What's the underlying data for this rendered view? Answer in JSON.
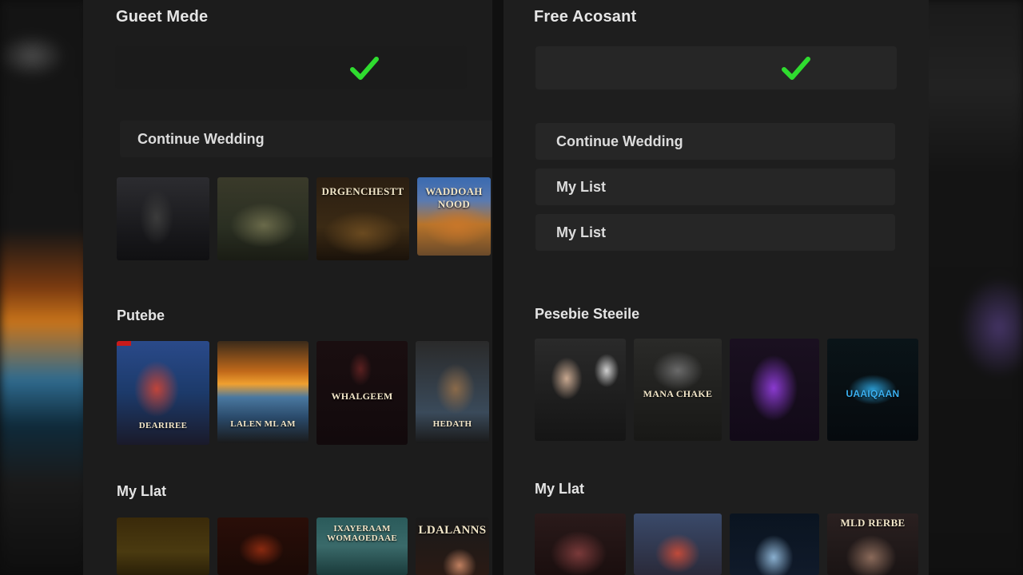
{
  "guest": {
    "title": "Gueet Mede",
    "continue_label": "Continue Wedding",
    "sections": {
      "continue_row": [
        {
          "name": "poster-dark-figures",
          "text": ""
        },
        {
          "name": "poster-table-group",
          "text": ""
        },
        {
          "name": "poster-grenches",
          "text": "DRGENCHESTT"
        },
        {
          "name": "poster-crowd",
          "text": "WADDOAH NOOD"
        }
      ],
      "popular_title": "Putebe",
      "popular_row": [
        {
          "name": "poster-dancers",
          "text": "DEARIREE"
        },
        {
          "name": "poster-sunset",
          "text": "LALEN ML AM"
        },
        {
          "name": "poster-shadow",
          "text": "WHALGEEM"
        },
        {
          "name": "poster-creature",
          "text": "HEDATH"
        }
      ],
      "mylist_title": "My Llat",
      "mylist_row": [
        {
          "name": "poster-golden",
          "text": ""
        },
        {
          "name": "poster-fire",
          "text": ""
        },
        {
          "name": "poster-teal",
          "text": "IXAYERAAM WOMAOEDAAE"
        },
        {
          "name": "poster-lalans",
          "text": "LDALANNS"
        }
      ]
    }
  },
  "free": {
    "title": "Free Acosant",
    "menu": [
      {
        "label": "Continue Wedding"
      },
      {
        "label": "My List"
      },
      {
        "label": "My List"
      }
    ],
    "sections": {
      "popular_title": "Pesebie Steeile",
      "popular_row": [
        {
          "name": "poster-two-faces",
          "text": ""
        },
        {
          "name": "poster-mana-chake",
          "text": "MANA CHAKE"
        },
        {
          "name": "poster-purple",
          "text": ""
        },
        {
          "name": "poster-blue-glow",
          "text": "UAAIQAAN"
        }
      ],
      "mylist_title": "My Llat",
      "mylist_row": [
        {
          "name": "poster-group-red",
          "text": ""
        },
        {
          "name": "poster-family",
          "text": ""
        },
        {
          "name": "poster-ghost",
          "text": ""
        },
        {
          "name": "poster-mld-rerbe",
          "text": "MLD RERBE"
        }
      ]
    }
  },
  "colors": {
    "check": "#2fdc2f",
    "panel": "#1c1c1c",
    "row": "#262626"
  },
  "icons": {
    "check": "check-icon"
  }
}
